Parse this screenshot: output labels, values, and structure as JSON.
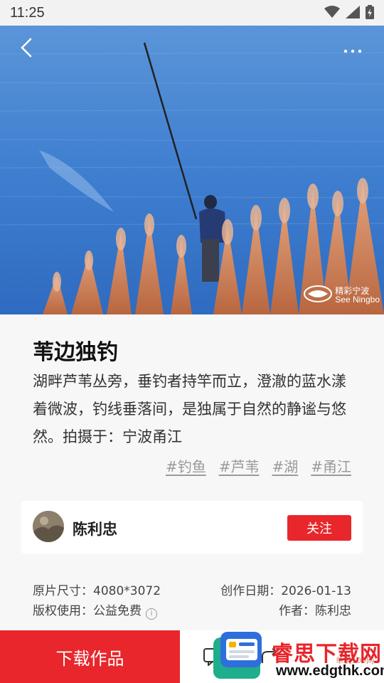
{
  "status_bar": {
    "time": "11:25"
  },
  "colors": {
    "accent": "#e8262b",
    "water": "#3b79c9",
    "reeds": "#d98a5e"
  },
  "icons": {
    "back": "chevron-left-icon",
    "more": "more-dots-icon",
    "wifi": "wifi-icon",
    "signal": "signal-icon",
    "battery": "battery-icon",
    "info": "info-icon"
  },
  "photo": {
    "watermark_cn": "精彩宁波",
    "watermark_en": "See Ningbo"
  },
  "post": {
    "title": "苇边独钓",
    "description": "湖畔芦苇丛旁，垂钓者持竿而立，澄澈的蓝水漾着微波，钓线垂落间，是独属于自然的静谧与悠然。拍摄于：宁波甬江",
    "tags": [
      "#钓鱼",
      "#芦苇",
      "#湖",
      "#甬江"
    ]
  },
  "author": {
    "name": "陈利忠",
    "follow_label": "关注"
  },
  "meta": {
    "size_label": "原片尺寸：",
    "size_value": "4080*3072",
    "date_label": "创作日期：",
    "date_value": "2026-01-13",
    "copyright_label": "版权使用：",
    "copyright_value": "公益免费",
    "author_label": "作者：",
    "author_value": "陈利忠"
  },
  "bottom_bar": {
    "download_label": "下载作品"
  },
  "overlay_logo": {
    "name": "睿思下载网",
    "sub": "单机100网",
    "url": "www.edgthk.com"
  }
}
